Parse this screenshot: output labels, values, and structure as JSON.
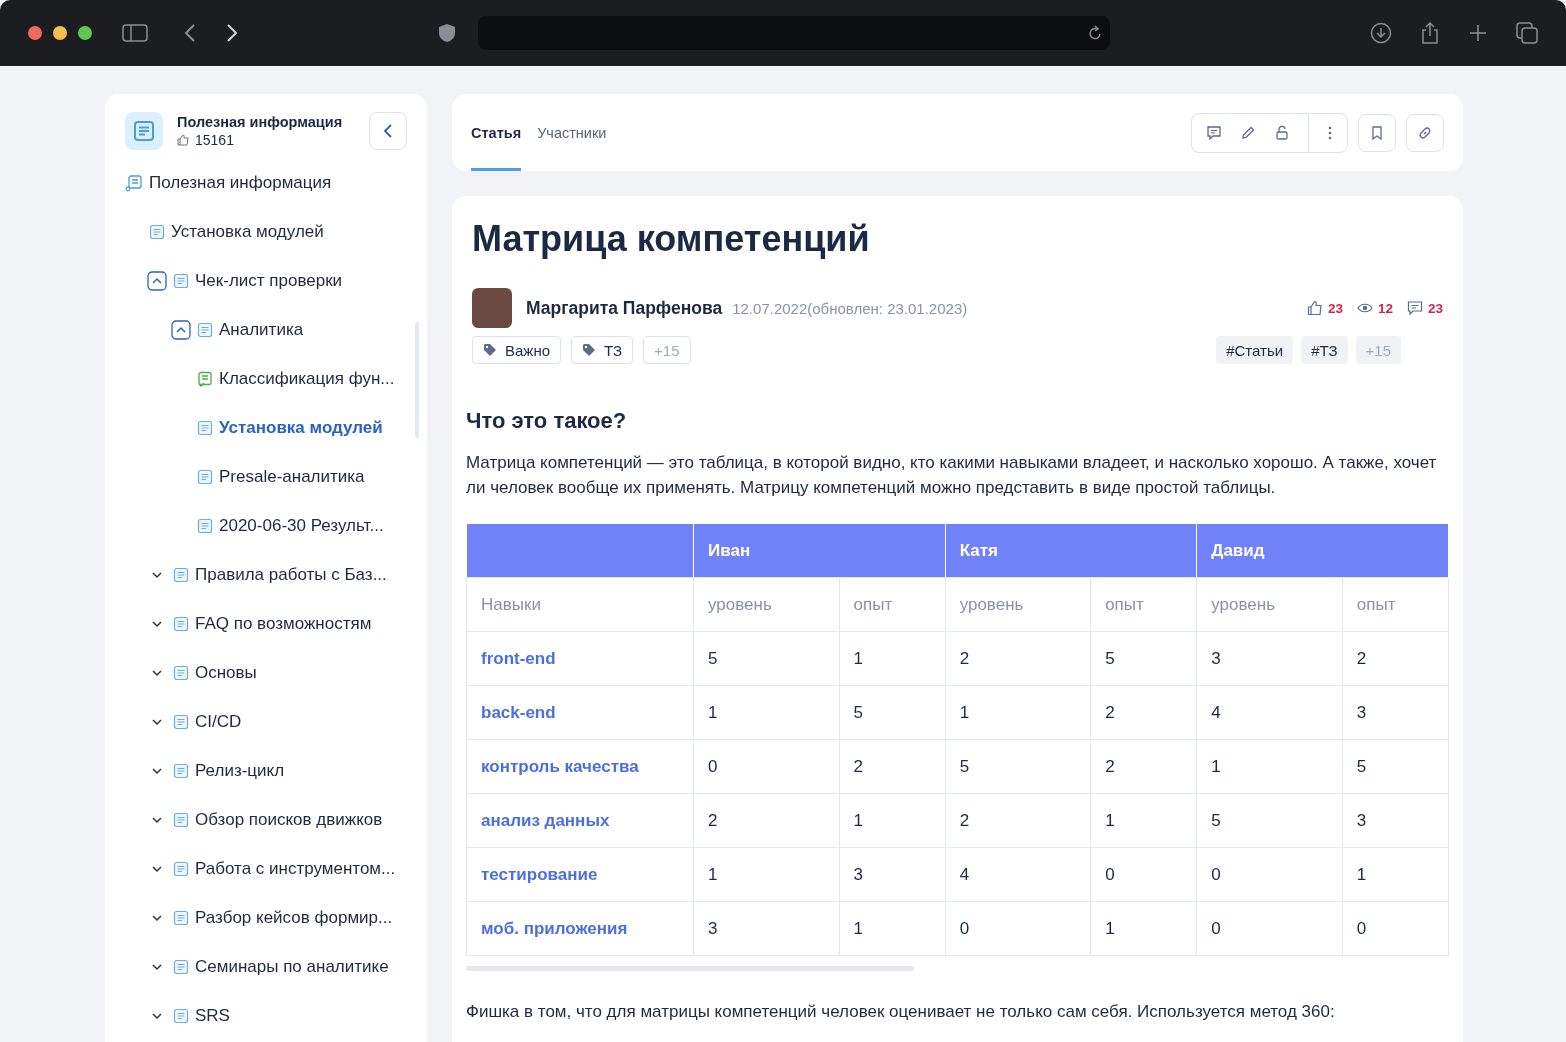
{
  "sidebar": {
    "title": "Полезная информация",
    "likes": "15161",
    "tree": [
      {
        "label": "Полезная информация",
        "kind": "root",
        "selected": false,
        "children": [
          {
            "label": "Установка модулей",
            "kind": "page",
            "selected": false
          },
          {
            "label": "Чек-лист проверки",
            "kind": "folder",
            "expanded": true,
            "selected": false,
            "children": [
              {
                "label": "Аналитика",
                "kind": "folder",
                "expanded": true,
                "selected": false,
                "children": [
                  {
                    "label": "Классификация фун...",
                    "kind": "review",
                    "selected": false
                  },
                  {
                    "label": "Установка модулей",
                    "kind": "page",
                    "selected": true
                  },
                  {
                    "label": "Presale-аналитика",
                    "kind": "page",
                    "selected": false
                  },
                  {
                    "label": "2020-06-30 Результ...",
                    "kind": "page",
                    "selected": false
                  }
                ]
              }
            ]
          },
          {
            "label": "Правила работы с Баз...",
            "kind": "folder",
            "expanded": false,
            "selected": false
          },
          {
            "label": "FAQ по возможностям",
            "kind": "folder",
            "expanded": false,
            "selected": false
          },
          {
            "label": "Основы",
            "kind": "folder",
            "expanded": false,
            "selected": false
          },
          {
            "label": "CI/CD",
            "kind": "folder",
            "expanded": false,
            "selected": false
          },
          {
            "label": "Релиз-цикл",
            "kind": "folder",
            "expanded": false,
            "selected": false
          },
          {
            "label": "Обзор поисков движков",
            "kind": "folder",
            "expanded": false,
            "selected": false
          },
          {
            "label": "Работа с инструментом...",
            "kind": "folder",
            "expanded": false,
            "selected": false
          },
          {
            "label": "Разбор кейсов формир...",
            "kind": "folder",
            "expanded": false,
            "selected": false
          },
          {
            "label": "Семинары по аналитике",
            "kind": "folder",
            "expanded": false,
            "selected": false
          },
          {
            "label": "SRS",
            "kind": "folder",
            "expanded": false,
            "selected": false
          }
        ]
      }
    ]
  },
  "tabs": [
    {
      "label": "Статья",
      "selected": true
    },
    {
      "label": "Участники",
      "selected": false
    }
  ],
  "article": {
    "title": "Матрица компетенций",
    "author": "Маргарита Парфенова",
    "date": "12.07.2022(обновлен: 23.01.2023)",
    "stats": [
      {
        "kind": "likes",
        "value": "23"
      },
      {
        "kind": "views",
        "value": "12"
      },
      {
        "kind": "comments",
        "value": "23"
      }
    ],
    "tags": [
      "Важно",
      "ТЗ"
    ],
    "tags_more": "+15",
    "hashtags": [
      "#Статьи",
      "#ТЗ"
    ],
    "hashtags_more": "+15",
    "heading": "Что это такое?",
    "intro": "Матрица компетенций — это таблица, в которой видно, кто какими навыками владеет, и насколько хорошо. А также, хочет ли человек вообще их применять. Матрицу компетенций можно представить в виде простой таблицы.",
    "table": {
      "people": [
        "Иван",
        "Катя",
        "Давид"
      ],
      "skill_header": "Навыки",
      "subheaders": [
        "уровень",
        "опыт",
        "уровень",
        "опыт",
        "уровень",
        "опыт"
      ],
      "rows": [
        {
          "skill": "front-end",
          "values": [
            "5",
            "1",
            "2",
            "5",
            "3",
            "2"
          ]
        },
        {
          "skill": "back-end",
          "values": [
            "1",
            "5",
            "1",
            "2",
            "4",
            "3"
          ]
        },
        {
          "skill": "контроль качества",
          "values": [
            "0",
            "2",
            "5",
            "2",
            "1",
            "5"
          ]
        },
        {
          "skill": "анализ данных",
          "values": [
            "2",
            "1",
            "2",
            "1",
            "5",
            "3"
          ]
        },
        {
          "skill": "тестирование",
          "values": [
            "1",
            "3",
            "4",
            "0",
            "0",
            "1"
          ]
        },
        {
          "skill": "моб. приложения",
          "values": [
            "3",
            "1",
            "0",
            "1",
            "0",
            "0"
          ]
        }
      ]
    },
    "outro": "Фишка в том, что для матрицы компетенций человек оценивает не только сам себя. Используется метод 360:"
  }
}
